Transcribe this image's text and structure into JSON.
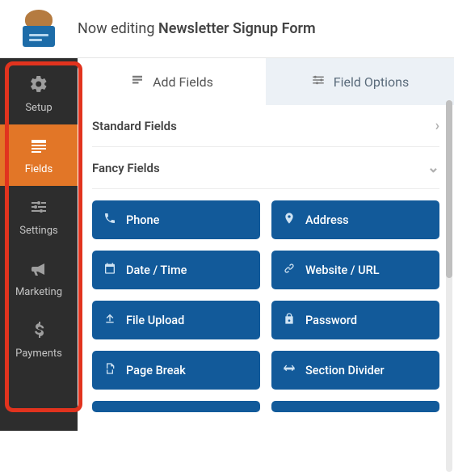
{
  "header": {
    "prefix": "Now editing ",
    "form_name": "Newsletter Signup Form"
  },
  "sidebar": {
    "items": [
      {
        "label": "Setup"
      },
      {
        "label": "Fields"
      },
      {
        "label": "Settings"
      },
      {
        "label": "Marketing"
      },
      {
        "label": "Payments"
      }
    ],
    "active_index": 1
  },
  "tabs": {
    "add_fields": "Add Fields",
    "field_options": "Field Options"
  },
  "sections": {
    "standard": "Standard Fields",
    "fancy": "Fancy Fields"
  },
  "fancy_fields": [
    {
      "label": "Phone"
    },
    {
      "label": "Address"
    },
    {
      "label": "Date / Time"
    },
    {
      "label": "Website / URL"
    },
    {
      "label": "File Upload"
    },
    {
      "label": "Password"
    },
    {
      "label": "Page Break"
    },
    {
      "label": "Section Divider"
    }
  ],
  "colors": {
    "accent": "#e27627",
    "field_button": "#125a9a",
    "highlight_border": "#e1331e"
  }
}
